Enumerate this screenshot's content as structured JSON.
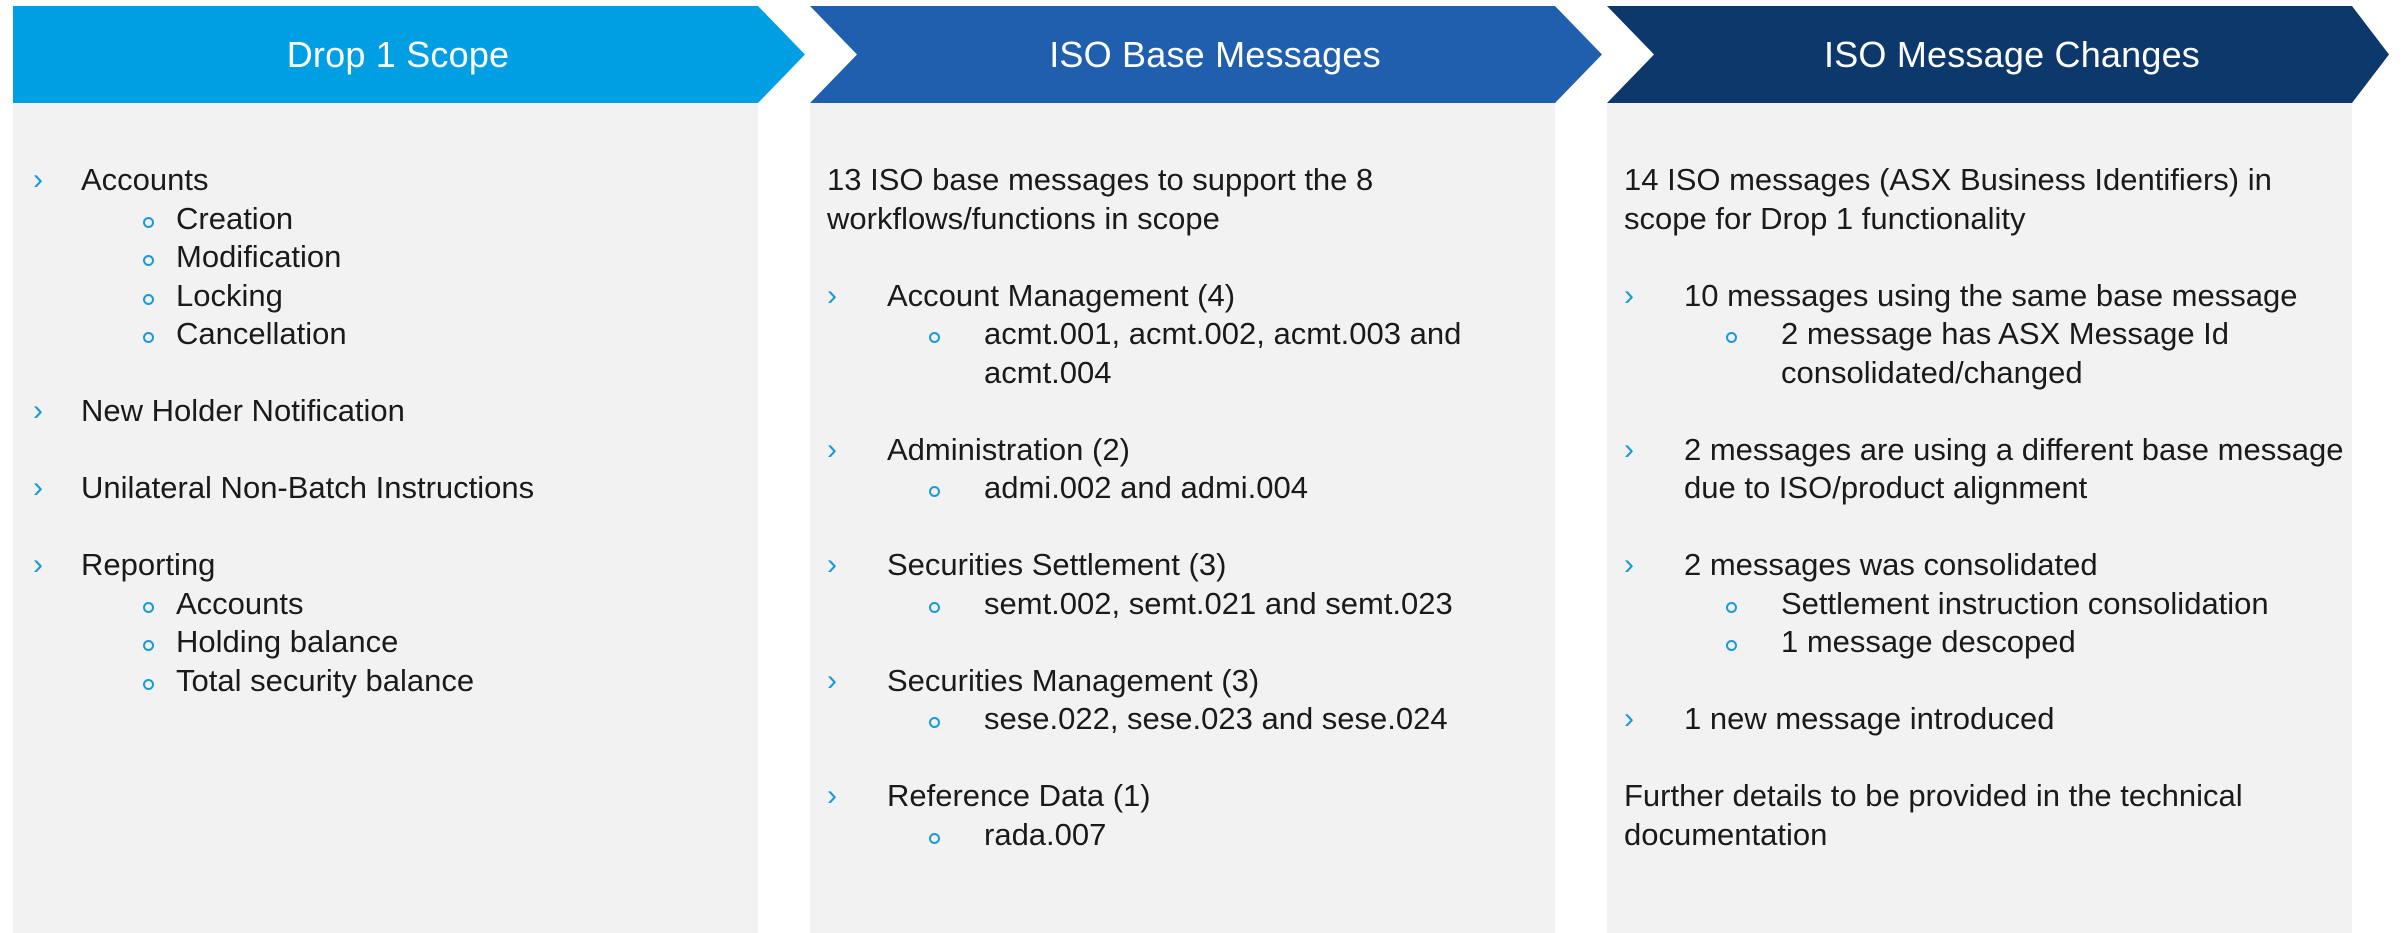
{
  "columns": [
    {
      "title": "Drop 1 Scope",
      "header_color": "#009fe3",
      "intro": "",
      "items": [
        {
          "label": "Accounts",
          "subitems": [
            "Creation",
            "Modification",
            "Locking",
            "Cancellation"
          ]
        },
        {
          "label": "New Holder Notification",
          "subitems": []
        },
        {
          "label": "Unilateral Non-Batch Instructions",
          "subitems": []
        },
        {
          "label": "Reporting",
          "subitems": [
            "Accounts",
            "Holding balance",
            "Total security balance"
          ]
        }
      ],
      "footer": ""
    },
    {
      "title": "ISO Base Messages",
      "header_color": "#1f5fad",
      "intro": "13 ISO base messages to support the 8 workflows/functions in scope",
      "items": [
        {
          "label": "Account Management (4)",
          "subitems": [
            "acmt.001, acmt.002, acmt.003 and acmt.004"
          ]
        },
        {
          "label": "Administration (2)",
          "subitems": [
            "admi.002 and admi.004"
          ]
        },
        {
          "label": "Securities Settlement (3)",
          "subitems": [
            "semt.002, semt.021 and semt.023"
          ]
        },
        {
          "label": "Securities Management (3)",
          "subitems": [
            "sese.022, sese.023 and sese.024"
          ]
        },
        {
          "label": "Reference Data (1)",
          "subitems": [
            "rada.007"
          ]
        }
      ],
      "footer": ""
    },
    {
      "title": "ISO Message Changes",
      "header_color": "#0c386b",
      "intro": "14 ISO messages (ASX Business Identifiers) in scope for Drop 1 functionality",
      "items": [
        {
          "label": "10 messages using the same base message",
          "subitems": [
            "2 message has ASX Message Id consolidated/changed"
          ]
        },
        {
          "label": "2 messages are using a different base message due to ISO/product alignment",
          "subitems": []
        },
        {
          "label": "2 messages was consolidated",
          "subitems": [
            "Settlement instruction consolidation",
            "1 message descoped"
          ]
        },
        {
          "label": "1 new message introduced",
          "subitems": []
        }
      ],
      "footer": "Further details to be provided in the technical documentation"
    }
  ],
  "colors": {
    "panel_bg": "#f2f2f2",
    "bullet": "#1a9ad6",
    "text": "#1a1a1a"
  },
  "icons": {
    "level1": "chevron-right-icon",
    "level2": "circle-bullet-icon"
  }
}
